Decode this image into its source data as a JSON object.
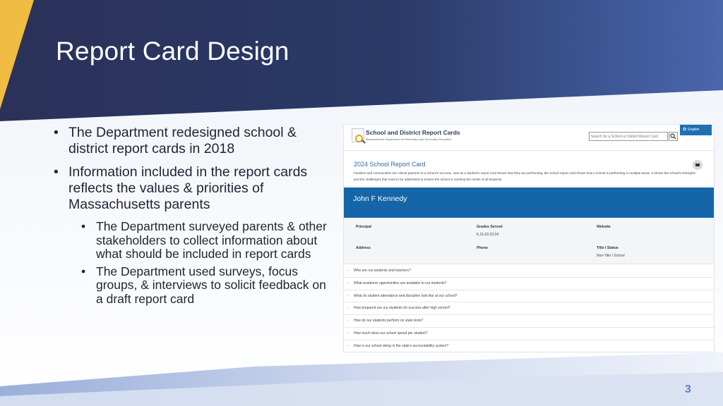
{
  "slide": {
    "title": "Report Card Design",
    "page_number": "3",
    "bullets": [
      "The Department redesigned school & district report cards in 2018",
      "Information included in the report cards reflects the values & priorities of Massachusetts parents"
    ],
    "sub_bullets": [
      "The Department surveyed parents & other stakeholders to collect information about what should be included in report cards",
      "The Department used surveys, focus groups, & interviews to solicit feedback on a draft report card"
    ]
  },
  "screenshot": {
    "site_title": "School and District Report Cards",
    "site_subtitle": "Massachusetts Department of Elementary and Secondary Education",
    "search_placeholder": "Search for a School or District Report Card",
    "language_label": "English",
    "report_title": "2024 School Report Card",
    "description": "Families and communities are critical partners to a school's success. Just as a student's report card shows how they are performing, the school report card shows how a school is performing in multiple areas. It shows the school's strengths and the challenges that need to be addressed to ensure the school is meeting the needs of all students.",
    "school_name": "John F Kennedy",
    "info": {
      "principal_label": "Principal",
      "grades_label": "Grades Served",
      "grades_value": "K,01,02,03,04",
      "website_label": "Website",
      "address_label": "Address",
      "phone_label": "Phone",
      "title1_label": "Title I Status",
      "title1_value": "Non-Title I School"
    },
    "questions": [
      "Who are our students and teachers?",
      "What academic opportunities are available to our students?",
      "What do student attendance and discipline look like at our school?",
      "How prepared are our students for success after high school?",
      "How do our students perform on state tests?",
      "How much does our school spend per student?",
      "How is our school doing in the state's accountability system?"
    ]
  },
  "colors": {
    "navy": "#28305a",
    "accent_gold": "#f0bc42",
    "report_blue": "#1566a8",
    "page_number": "#5b7fc7"
  }
}
